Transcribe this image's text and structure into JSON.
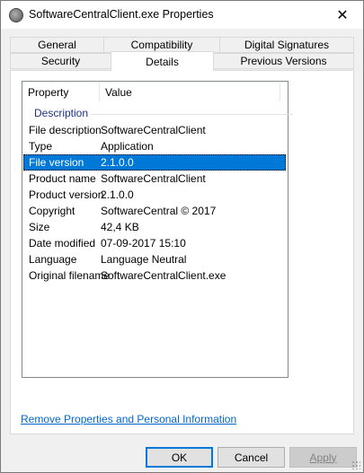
{
  "window": {
    "title": "SoftwareCentralClient.exe Properties",
    "close_glyph": "✕"
  },
  "tabs": {
    "row1": [
      "General",
      "Compatibility",
      "Digital Signatures"
    ],
    "row2": [
      "Security",
      "Details",
      "Previous Versions"
    ],
    "active": "Details"
  },
  "details": {
    "columns": [
      "Property",
      "Value"
    ],
    "group": "Description",
    "rows": [
      {
        "property": "File description",
        "value": "SoftwareCentralClient"
      },
      {
        "property": "Type",
        "value": "Application"
      },
      {
        "property": "File version",
        "value": "2.1.0.0",
        "selected": true
      },
      {
        "property": "Product name",
        "value": "SoftwareCentralClient"
      },
      {
        "property": "Product version",
        "value": "2.1.0.0"
      },
      {
        "property": "Copyright",
        "value": "SoftwareCentral © 2017"
      },
      {
        "property": "Size",
        "value": "42,4 KB"
      },
      {
        "property": "Date modified",
        "value": "07-09-2017 15:10"
      },
      {
        "property": "Language",
        "value": "Language Neutral"
      },
      {
        "property": "Original filename",
        "value": "SoftwareCentralClient.exe"
      }
    ]
  },
  "link": {
    "remove_properties": "Remove Properties and Personal Information"
  },
  "buttons": {
    "ok": "OK",
    "cancel": "Cancel",
    "apply": "Apply"
  },
  "colors": {
    "selection": "#0078d7",
    "link": "#0066cc",
    "group_heading": "#1e3287"
  },
  "icons": {
    "app": "app-disc-icon",
    "close": "close-icon",
    "resize": "resize-grip-icon"
  }
}
